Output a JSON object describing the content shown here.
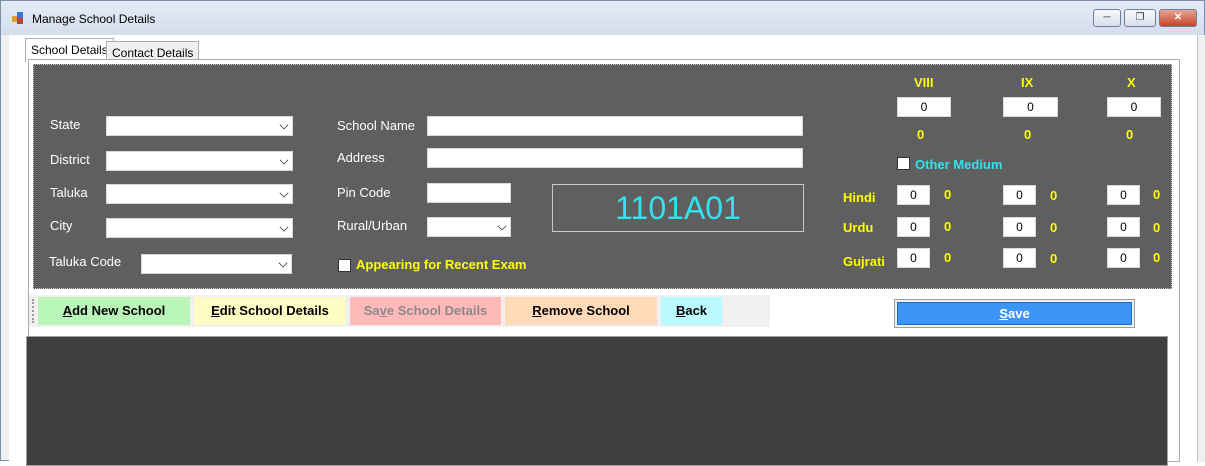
{
  "window": {
    "title": "Manage School Details",
    "minimize_icon": "minimize-icon",
    "restore_icon": "restore-icon",
    "close_icon": "close-icon"
  },
  "tabs": [
    {
      "label": "School Details",
      "active": true
    },
    {
      "label": "Contact Details",
      "active": false
    }
  ],
  "form": {
    "state_label": "State",
    "district_label": "District",
    "taluka_label": "Taluka",
    "city_label": "City",
    "taluka_code_label": "Taluka Code",
    "school_name_label": "School Name",
    "address_label": "Address",
    "pin_code_label": "Pin Code",
    "rural_urban_label": "Rural/Urban",
    "appearing_label": "Appearing for Recent Exam",
    "school_name_value": "",
    "address_value": "",
    "pin_code_value": ""
  },
  "school_code": "1101A01",
  "grades": {
    "headers": [
      "VIII",
      "IX",
      "X"
    ],
    "inputs": [
      "0",
      "0",
      "0"
    ],
    "totals": [
      "0",
      "0",
      "0"
    ]
  },
  "medium": {
    "other_label": "Other Medium",
    "rows": [
      {
        "label": "Hindi",
        "inputs": [
          "0",
          "0",
          "0"
        ],
        "values": [
          "0",
          "0",
          "0"
        ]
      },
      {
        "label": "Urdu",
        "inputs": [
          "0",
          "0",
          "0"
        ],
        "values": [
          "0",
          "0",
          "0"
        ]
      },
      {
        "label": "Gujrati",
        "inputs": [
          "0",
          "0",
          "0"
        ],
        "values": [
          "0",
          "0",
          "0"
        ]
      }
    ]
  },
  "toolbar": {
    "add_first": "A",
    "add_rest": "dd New School",
    "edit_first": "E",
    "edit_rest": "dit School Details",
    "save_details_pre": "Sa",
    "save_details_ul": "v",
    "save_details_post": "e School Details",
    "remove_first": "R",
    "remove_rest": "emove School",
    "back_first": "B",
    "back_rest": "ack"
  },
  "save_button": {
    "first": "S",
    "rest": "ave"
  },
  "colors": {
    "panel_bg": "#5f5f5f",
    "label_yellow": "#ffff00",
    "code_cyan": "#2fe4ef",
    "add_bg": "#b9f5b9",
    "edit_bg": "#fffbc4",
    "save_details_bg": "#ffb9b9",
    "remove_bg": "#ffdab9",
    "back_bg": "#b9f9ff",
    "save_bg": "#3d95f5",
    "grid_bg": "#404040"
  }
}
